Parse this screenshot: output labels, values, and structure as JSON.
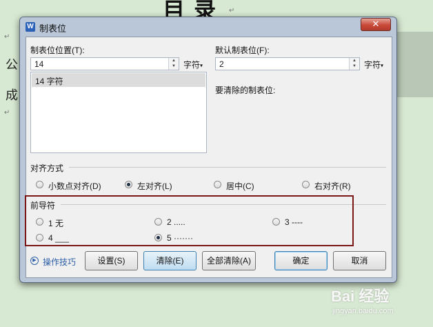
{
  "document": {
    "title": "目 录",
    "line1": "公",
    "line2": "成"
  },
  "dialog": {
    "title": "制表位",
    "close_symbol": "✕",
    "tab_position_label": "制表位位置(T):",
    "tab_position_value": "14",
    "tab_position_unit": "字符",
    "default_tab_label": "默认制表位(F):",
    "default_tab_value": "2",
    "default_tab_unit": "字符",
    "tab_list": [
      "14 字符"
    ],
    "clear_label": "要清除的制表位:",
    "alignment": {
      "group_label": "对齐方式",
      "options": [
        {
          "label": "小数点对齐(D)",
          "checked": false
        },
        {
          "label": "左对齐(L)",
          "checked": true
        },
        {
          "label": "居中(C)",
          "checked": false
        },
        {
          "label": "右对齐(R)",
          "checked": false
        }
      ]
    },
    "leader": {
      "group_label": "前导符",
      "options": [
        {
          "label": "1 无",
          "checked": false
        },
        {
          "label": "2 .....",
          "checked": false
        },
        {
          "label": "3 ----",
          "checked": false
        },
        {
          "label": "4 ___",
          "checked": false
        },
        {
          "label": "5 ·······",
          "checked": true
        }
      ]
    },
    "buttons": {
      "tips": "操作技巧",
      "set": "设置(S)",
      "clear": "清除(E)",
      "clear_all": "全部清除(A)",
      "ok": "确定",
      "cancel": "取消"
    },
    "highlight_color": "#7a1717",
    "accent_color": "#2c5fa8"
  },
  "watermark": {
    "text": "Bai 经验",
    "url": "jingyan.baidu.com"
  }
}
